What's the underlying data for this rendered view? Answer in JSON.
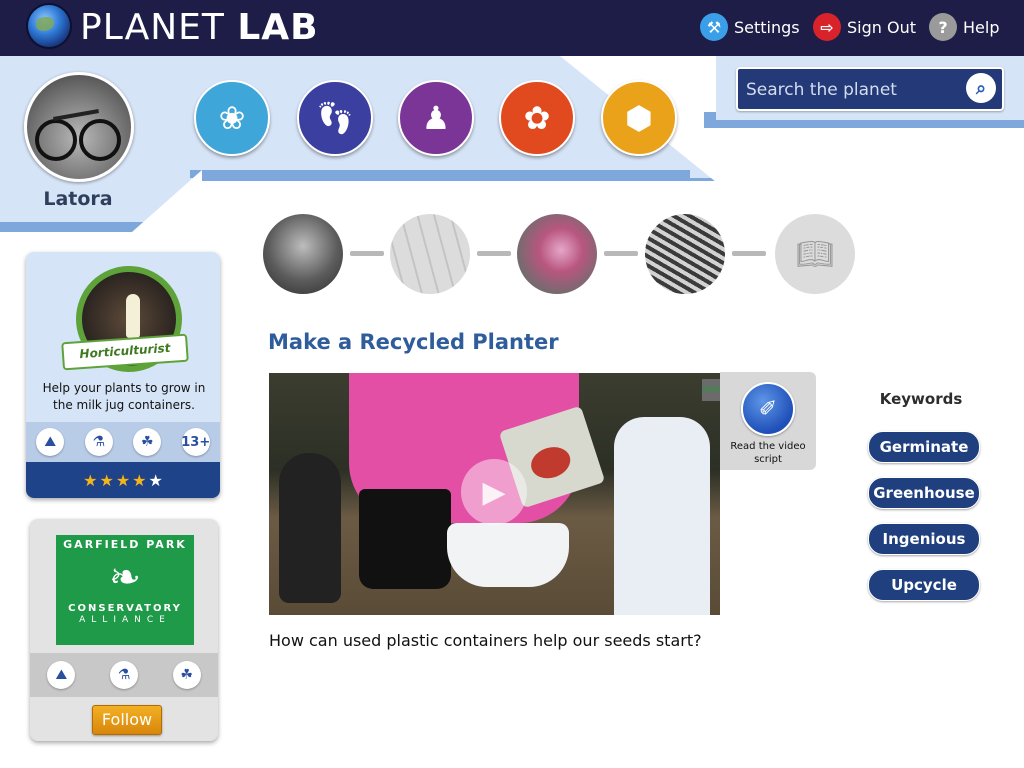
{
  "app": {
    "logo_light": "PLANET",
    "logo_bold": "LAB"
  },
  "topnav": {
    "settings": "Settings",
    "sign_out": "Sign Out",
    "help": "Help",
    "help_glyph": "?"
  },
  "profile": {
    "name": "Latora"
  },
  "categories": [
    {
      "icon": "connections-icon",
      "color": "#3ea6d8"
    },
    {
      "icon": "footprints-icon",
      "color": "#3a3fa0"
    },
    {
      "icon": "community-icon",
      "color": "#7a3596"
    },
    {
      "icon": "cooperation-icon",
      "color": "#e14a1f"
    },
    {
      "icon": "honeycomb-icon",
      "color": "#eaa21a"
    }
  ],
  "search": {
    "placeholder": "Search the planet"
  },
  "badge_card": {
    "badge_title": "Horticulturist",
    "description": "Help your plants to grow in the milk jug containers.",
    "age": "13+",
    "rating": 4,
    "rating_max": 5
  },
  "partner_card": {
    "logo_top": "GARFIELD PARK",
    "logo_middle": "CONSERVATORY",
    "logo_bottom": "ALLIANCE",
    "follow_label": "Follow"
  },
  "steps": [
    {
      "name": "seed-sprout"
    },
    {
      "name": "map"
    },
    {
      "name": "planter-video",
      "active": true
    },
    {
      "name": "seedlings"
    },
    {
      "name": "journal"
    }
  ],
  "lesson": {
    "title": "Make a Recycled Planter",
    "question": "How can used plastic containers help our seeds start?",
    "video_corner_text": "eHo"
  },
  "script": {
    "label": "Read the video script"
  },
  "keywords": {
    "title": "Keywords",
    "items": [
      "Germinate",
      "Greenhouse",
      "Ingenious",
      "Upcycle"
    ]
  },
  "colors": {
    "topbar": "#1d1d47",
    "band": "#d6e4f7",
    "band_border": "#7ea7dc",
    "title_blue": "#2f5d9c",
    "keyword_bg": "#1f3f7e",
    "follow_orange": "#f4b024"
  }
}
